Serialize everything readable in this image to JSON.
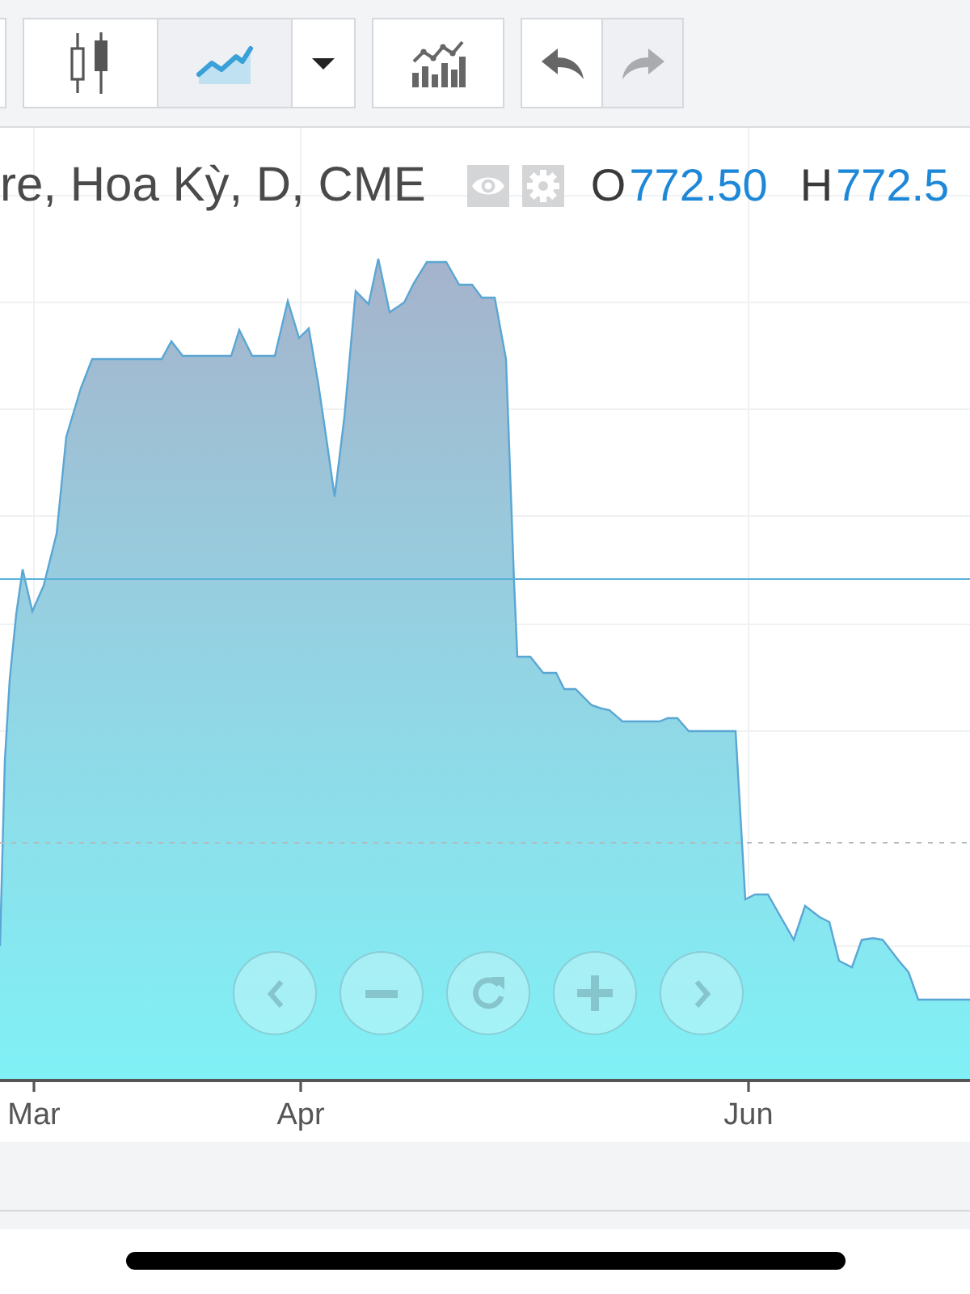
{
  "toolbar": {
    "chart_types": [
      {
        "kind": "candles",
        "selected": false
      },
      {
        "kind": "area",
        "selected": true
      }
    ],
    "history": [
      {
        "kind": "undo",
        "disabled": false
      },
      {
        "kind": "redo",
        "disabled": true
      }
    ]
  },
  "legend": {
    "title": "re, Hoa Kỳ, D, CME",
    "values": [
      {
        "label": "O",
        "value": "772.50"
      },
      {
        "label": "H",
        "value": "772.5"
      }
    ]
  },
  "chart": {
    "x_labels": [
      "Mar",
      "Apr",
      "Jun"
    ]
  }
}
